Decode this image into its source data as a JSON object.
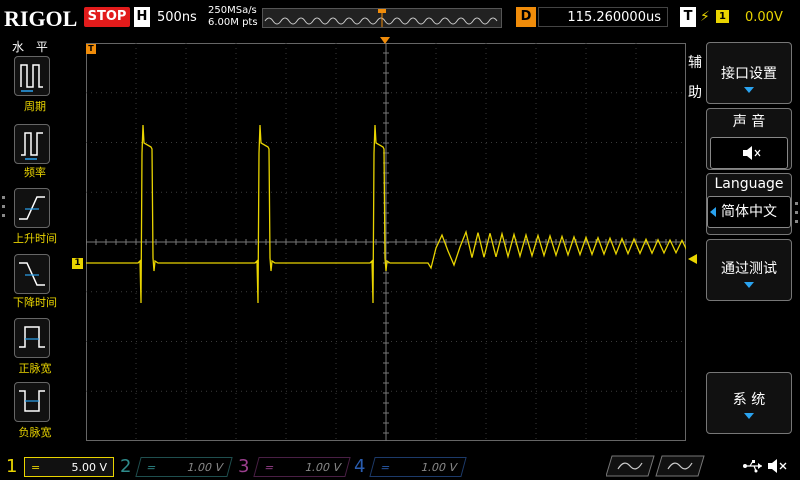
{
  "header": {
    "logo": "RIGOL",
    "run_state": "STOP",
    "timebase_badge": "H",
    "timebase": "500ns",
    "sample_rate": "250MSa/s",
    "memory_depth": "6.00M pts",
    "delay_badge": "D",
    "delay_value": "115.260000us",
    "trigger_badge": "T",
    "trigger_edge_symbol": "⚡",
    "trigger_channel": "1",
    "trigger_level": "0.00V"
  },
  "left_panel": {
    "title": "水 平",
    "items": [
      {
        "label": "周期",
        "icon": "period-icon"
      },
      {
        "label": "频率",
        "icon": "frequency-icon"
      },
      {
        "label": "上升时间",
        "icon": "rise-time-icon"
      },
      {
        "label": "下降时间",
        "icon": "fall-time-icon"
      },
      {
        "label": "正脉宽",
        "icon": "positive-width-icon"
      },
      {
        "label": "负脉宽",
        "icon": "negative-width-icon"
      }
    ]
  },
  "right_menu": {
    "side_label_1": "辅",
    "side_label_2": "助",
    "interface_settings": "接口设置",
    "sound_title": "声 音",
    "language_title": "Language",
    "language_value": "简体中文",
    "pass_fail": "通过测试",
    "system": "系 统"
  },
  "markers": {
    "channel1": "1",
    "trigger_pos": "T"
  },
  "bottom_bar": {
    "channels": [
      {
        "num": "1",
        "scale": "5.00 V",
        "color": "#e9d400",
        "active": true
      },
      {
        "num": "2",
        "scale": "1.00 V",
        "color": "#2e8b8b",
        "active": false
      },
      {
        "num": "3",
        "scale": "1.00 V",
        "color": "#9b3f8e",
        "active": false
      },
      {
        "num": "4",
        "scale": "1.00 V",
        "color": "#2a5db0",
        "active": false
      }
    ]
  },
  "colors": {
    "ch1": "#e9d400",
    "accent": "#f08c0a",
    "stop": "#e21b1b",
    "menu_arrow": "#2aa3f0",
    "grid": "#3a3a3a"
  }
}
